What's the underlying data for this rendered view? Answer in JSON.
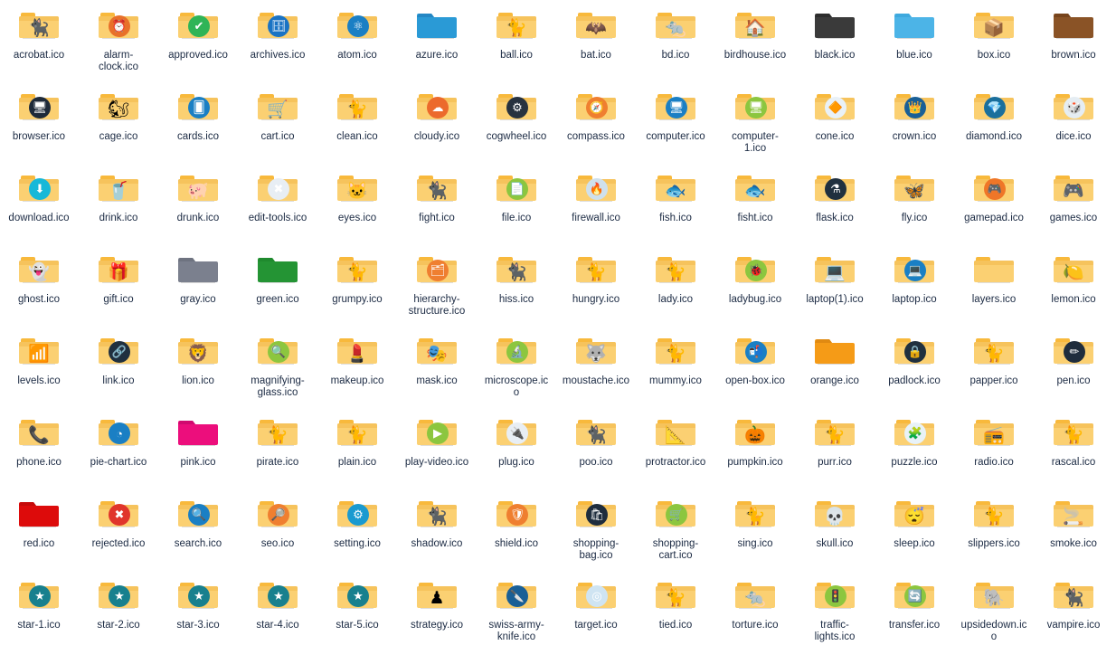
{
  "view": {
    "type": "file-explorer-icon-grid",
    "columns": 14,
    "rows": 7,
    "background": "#ffffff",
    "label_color": "#1b2a43",
    "folder_colors": {
      "yellow_body": "#fbd072",
      "yellow_tab": "#f8b93c",
      "yellow_edge": "#f6c35c",
      "blue": "#2a9ad6",
      "light_blue": "#4cb4e7",
      "black": "#333333",
      "brown": "#8a5326",
      "gray": "#7b808e",
      "green": "#249434",
      "orange": "#f59b17",
      "pink": "#ec0e7c",
      "red": "#dd0b0b",
      "shadow": "#c9c9c9"
    }
  },
  "files": [
    {
      "name": "acrobat.ico",
      "folder": "yellow",
      "glyph": "🐈‍⬛",
      "icon_name": "black-cat"
    },
    {
      "name": "alarm-clock.ico",
      "folder": "yellow",
      "glyph": "⏰",
      "icon_name": "alarm-clock",
      "disc": "#e8702a"
    },
    {
      "name": "approved.ico",
      "folder": "yellow",
      "glyph": "✔",
      "icon_name": "check-mark",
      "disc": "#2fb457"
    },
    {
      "name": "archives.ico",
      "folder": "yellow",
      "glyph": "🗄",
      "icon_name": "archive-box",
      "disc": "#1a73c4"
    },
    {
      "name": "atom.ico",
      "folder": "yellow",
      "glyph": "⚛",
      "icon_name": "atom",
      "disc": "#1b7fc4"
    },
    {
      "name": "azure.ico",
      "folder": "blue",
      "glyph": "",
      "icon_name": "plain-blue-folder"
    },
    {
      "name": "ball.ico",
      "folder": "yellow",
      "glyph": "🐈",
      "icon_name": "cat-with-ball"
    },
    {
      "name": "bat.ico",
      "folder": "yellow",
      "glyph": "🦇",
      "icon_name": "bat"
    },
    {
      "name": "bd.ico",
      "folder": "yellow",
      "glyph": "🐀",
      "icon_name": "rodent"
    },
    {
      "name": "birdhouse.ico",
      "folder": "yellow",
      "glyph": "🏠",
      "icon_name": "birdhouse"
    },
    {
      "name": "black.ico",
      "folder": "black",
      "glyph": "",
      "icon_name": "plain-black-folder"
    },
    {
      "name": "blue.ico",
      "folder": "light_blue",
      "glyph": "",
      "icon_name": "plain-lightblue-folder"
    },
    {
      "name": "box.ico",
      "folder": "yellow",
      "glyph": "📦",
      "icon_name": "cat-in-box"
    },
    {
      "name": "brown.ico",
      "folder": "brown",
      "glyph": "",
      "icon_name": "plain-brown-folder"
    },
    {
      "name": "browser.ico",
      "folder": "yellow",
      "glyph": "🖥",
      "icon_name": "browser-window",
      "disc": "#1e2a3a"
    },
    {
      "name": "cage.ico",
      "folder": "yellow",
      "glyph": "🐿",
      "icon_name": "caged-animal"
    },
    {
      "name": "cards.ico",
      "folder": "yellow",
      "glyph": "🂠",
      "icon_name": "playing-cards",
      "disc": "#1a7fc4"
    },
    {
      "name": "cart.ico",
      "folder": "yellow",
      "glyph": "🛒",
      "icon_name": "shopping-basket"
    },
    {
      "name": "clean.ico",
      "folder": "yellow",
      "glyph": "🐈",
      "icon_name": "grey-cat"
    },
    {
      "name": "cloudy.ico",
      "folder": "yellow",
      "glyph": "☁",
      "icon_name": "cloud",
      "disc": "#ec6a2c"
    },
    {
      "name": "cogwheel.ico",
      "folder": "yellow",
      "glyph": "⚙",
      "icon_name": "cogwheel",
      "disc": "#27323f"
    },
    {
      "name": "compass.ico",
      "folder": "yellow",
      "glyph": "🧭",
      "icon_name": "compass",
      "disc": "#ef7f30"
    },
    {
      "name": "computer.ico",
      "folder": "yellow",
      "glyph": "🖥",
      "icon_name": "computer-monitor",
      "disc": "#1a7fc4"
    },
    {
      "name": "computer-1.ico",
      "folder": "yellow",
      "glyph": "🖥",
      "icon_name": "computer-monitor-alt",
      "disc": "#8cc63f"
    },
    {
      "name": "cone.ico",
      "folder": "yellow",
      "glyph": "🔶",
      "icon_name": "traffic-cone",
      "disc": "#e9f1f7"
    },
    {
      "name": "crown.ico",
      "folder": "yellow",
      "glyph": "👑",
      "icon_name": "crown",
      "disc": "#1a5f96"
    },
    {
      "name": "diamond.ico",
      "folder": "yellow",
      "glyph": "💎",
      "icon_name": "diamond",
      "disc": "#1a6f9c"
    },
    {
      "name": "dice.ico",
      "folder": "yellow",
      "glyph": "🎲",
      "icon_name": "dice",
      "disc": "#e5edf3"
    },
    {
      "name": "download.ico",
      "folder": "yellow",
      "glyph": "⬇",
      "icon_name": "download-arrow",
      "disc": "#17b8d8"
    },
    {
      "name": "drink.ico",
      "folder": "yellow",
      "glyph": "🥤",
      "icon_name": "cat-drinking"
    },
    {
      "name": "drunk.ico",
      "folder": "yellow",
      "glyph": "🐖",
      "icon_name": "drunk-animal"
    },
    {
      "name": "edit-tools.ico",
      "folder": "yellow",
      "glyph": "✖",
      "icon_name": "close-cross",
      "disc": "#e8eef4"
    },
    {
      "name": "eyes.ico",
      "folder": "yellow",
      "glyph": "🐱",
      "icon_name": "white-cat-eyes"
    },
    {
      "name": "fight.ico",
      "folder": "yellow",
      "glyph": "🐈‍⬛",
      "icon_name": "fighting-cat"
    },
    {
      "name": "file.ico",
      "folder": "yellow",
      "glyph": "📄",
      "icon_name": "file-document",
      "disc": "#8cc63f"
    },
    {
      "name": "firewall.ico",
      "folder": "yellow",
      "glyph": "🔥",
      "icon_name": "firewall",
      "disc": "#cfe0ec"
    },
    {
      "name": "fish.ico",
      "folder": "yellow",
      "glyph": "🐟",
      "icon_name": "cat-and-fishbowl"
    },
    {
      "name": "fisht.ico",
      "folder": "yellow",
      "glyph": "🐟",
      "icon_name": "fish-tank"
    },
    {
      "name": "flask.ico",
      "folder": "yellow",
      "glyph": "⚗",
      "icon_name": "flask",
      "disc": "#20303f"
    },
    {
      "name": "fly.ico",
      "folder": "yellow",
      "glyph": "🦋",
      "icon_name": "flying-creature"
    },
    {
      "name": "gamepad.ico",
      "folder": "yellow",
      "glyph": "🎮",
      "icon_name": "gamepad",
      "disc": "#ef7628"
    },
    {
      "name": "games.ico",
      "folder": "yellow",
      "glyph": "🎮",
      "icon_name": "game-controller"
    },
    {
      "name": "ghost.ico",
      "folder": "yellow",
      "glyph": "👻",
      "icon_name": "ghost-cat"
    },
    {
      "name": "gift.ico",
      "folder": "yellow",
      "glyph": "🎁",
      "icon_name": "gift-cat"
    },
    {
      "name": "gray.ico",
      "folder": "gray",
      "glyph": "",
      "icon_name": "plain-gray-folder"
    },
    {
      "name": "green.ico",
      "folder": "green",
      "glyph": "",
      "icon_name": "plain-green-folder"
    },
    {
      "name": "grumpy.ico",
      "folder": "yellow",
      "glyph": "🐈",
      "icon_name": "grumpy-cat"
    },
    {
      "name": "hierarchy-structure.ico",
      "folder": "yellow",
      "glyph": "🗂",
      "icon_name": "hierarchy-structure",
      "disc": "#ef7f30"
    },
    {
      "name": "hiss.ico",
      "folder": "yellow",
      "glyph": "🐈‍⬛",
      "icon_name": "hissing-cat"
    },
    {
      "name": "hungry.ico",
      "folder": "yellow",
      "glyph": "🐈",
      "icon_name": "hungry-cat"
    },
    {
      "name": "lady.ico",
      "folder": "yellow",
      "glyph": "🐈",
      "icon_name": "lady-cat"
    },
    {
      "name": "ladybug.ico",
      "folder": "yellow",
      "glyph": "🐞",
      "icon_name": "ladybug",
      "disc": "#8cc63f"
    },
    {
      "name": "laptop(1).ico",
      "folder": "yellow",
      "glyph": "💻",
      "icon_name": "laptop"
    },
    {
      "name": "laptop.ico",
      "folder": "yellow",
      "glyph": "💻",
      "icon_name": "laptop-alt",
      "disc": "#1a7fc4"
    },
    {
      "name": "layers.ico",
      "folder": "plain_yellow",
      "glyph": "",
      "icon_name": "layers-folder"
    },
    {
      "name": "lemon.ico",
      "folder": "yellow",
      "glyph": "🍋",
      "icon_name": "lemon"
    },
    {
      "name": "levels.ico",
      "folder": "yellow",
      "glyph": "📶",
      "icon_name": "levels-bars"
    },
    {
      "name": "link.ico",
      "folder": "yellow",
      "glyph": "🔗",
      "icon_name": "link-chain",
      "disc": "#20303f"
    },
    {
      "name": "lion.ico",
      "folder": "yellow",
      "glyph": "🦁",
      "icon_name": "lion"
    },
    {
      "name": "magnifying-glass.ico",
      "folder": "yellow",
      "glyph": "🔍",
      "icon_name": "magnifying-glass",
      "disc": "#8cc63f"
    },
    {
      "name": "makeup.ico",
      "folder": "yellow",
      "glyph": "💄",
      "icon_name": "makeup"
    },
    {
      "name": "mask.ico",
      "folder": "yellow",
      "glyph": "🎭",
      "icon_name": "mask"
    },
    {
      "name": "microscope.ico",
      "folder": "yellow",
      "glyph": "🔬",
      "icon_name": "microscope",
      "disc": "#8cc63f"
    },
    {
      "name": "moustache.ico",
      "folder": "yellow",
      "glyph": "🐺",
      "icon_name": "moustache-animal"
    },
    {
      "name": "mummy.ico",
      "folder": "yellow",
      "glyph": "🐈",
      "icon_name": "mummy-cat"
    },
    {
      "name": "open-box.ico",
      "folder": "yellow",
      "glyph": "📬",
      "icon_name": "open-box",
      "disc": "#1a7fc4"
    },
    {
      "name": "orange.ico",
      "folder": "orange",
      "glyph": "",
      "icon_name": "plain-orange-folder"
    },
    {
      "name": "padlock.ico",
      "folder": "yellow",
      "glyph": "🔒",
      "icon_name": "padlock",
      "disc": "#20303f"
    },
    {
      "name": "papper.ico",
      "folder": "yellow",
      "glyph": "🐈",
      "icon_name": "paper-cat"
    },
    {
      "name": "pen.ico",
      "folder": "yellow",
      "glyph": "✏",
      "icon_name": "pen",
      "disc": "#1f2d3d"
    },
    {
      "name": "phone.ico",
      "folder": "yellow",
      "glyph": "📞",
      "icon_name": "phone-cat"
    },
    {
      "name": "pie-chart.ico",
      "folder": "yellow",
      "glyph": "◔",
      "icon_name": "pie-chart",
      "disc": "#1a7fc4"
    },
    {
      "name": "pink.ico",
      "folder": "pink",
      "glyph": "",
      "icon_name": "plain-pink-folder"
    },
    {
      "name": "pirate.ico",
      "folder": "yellow",
      "glyph": "🐈",
      "icon_name": "pirate-cat"
    },
    {
      "name": "plain.ico",
      "folder": "yellow",
      "glyph": "🐈",
      "icon_name": "plain-cat"
    },
    {
      "name": "play-video.ico",
      "folder": "yellow",
      "glyph": "▶",
      "icon_name": "play-video",
      "disc": "#8cc63f"
    },
    {
      "name": "plug.ico",
      "folder": "yellow",
      "glyph": "🔌",
      "icon_name": "plug",
      "disc": "#e8eef4"
    },
    {
      "name": "poo.ico",
      "folder": "yellow",
      "glyph": "🐈‍⬛",
      "icon_name": "poo-cat"
    },
    {
      "name": "protractor.ico",
      "folder": "yellow",
      "glyph": "📐",
      "icon_name": "protractor"
    },
    {
      "name": "pumpkin.ico",
      "folder": "yellow",
      "glyph": "🎃",
      "icon_name": "pumpkin-cat"
    },
    {
      "name": "purr.ico",
      "folder": "yellow",
      "glyph": "🐈",
      "icon_name": "purring-cat"
    },
    {
      "name": "puzzle.ico",
      "folder": "yellow",
      "glyph": "🧩",
      "icon_name": "puzzle-piece",
      "disc": "#e8f2f8"
    },
    {
      "name": "radio.ico",
      "folder": "yellow",
      "glyph": "📻",
      "icon_name": "radio-microphone"
    },
    {
      "name": "rascal.ico",
      "folder": "yellow",
      "glyph": "🐈",
      "icon_name": "rascal-cat"
    },
    {
      "name": "red.ico",
      "folder": "red",
      "glyph": "",
      "icon_name": "plain-red-folder"
    },
    {
      "name": "rejected.ico",
      "folder": "yellow",
      "glyph": "✖",
      "icon_name": "rejected-cross",
      "disc": "#e0352b"
    },
    {
      "name": "search.ico",
      "folder": "yellow",
      "glyph": "🔍",
      "icon_name": "search-magnifier",
      "disc": "#1a7fc4"
    },
    {
      "name": "seo.ico",
      "folder": "yellow",
      "glyph": "🔎",
      "icon_name": "seo-magnifier",
      "disc": "#ef7f30"
    },
    {
      "name": "setting.ico",
      "folder": "yellow",
      "glyph": "⚙",
      "icon_name": "settings-gear",
      "disc": "#1a9ad0"
    },
    {
      "name": "shadow.ico",
      "folder": "yellow",
      "glyph": "🐈‍⬛",
      "icon_name": "shadow-cat"
    },
    {
      "name": "shield.ico",
      "folder": "yellow",
      "glyph": "🛡",
      "icon_name": "shield",
      "disc": "#ef7f30"
    },
    {
      "name": "shopping-bag.ico",
      "folder": "yellow",
      "glyph": "🛍",
      "icon_name": "shopping-bag",
      "disc": "#1f2d3d"
    },
    {
      "name": "shopping-cart.ico",
      "folder": "yellow",
      "glyph": "🛒",
      "icon_name": "shopping-cart",
      "disc": "#8cc63f"
    },
    {
      "name": "sing.ico",
      "folder": "yellow",
      "glyph": "🐈",
      "icon_name": "singing-cat"
    },
    {
      "name": "skull.ico",
      "folder": "yellow",
      "glyph": "💀",
      "icon_name": "skull-cat"
    },
    {
      "name": "sleep.ico",
      "folder": "yellow",
      "glyph": "😴",
      "icon_name": "sleeping-cat"
    },
    {
      "name": "slippers.ico",
      "folder": "yellow",
      "glyph": "🐈",
      "icon_name": "slippers-cat"
    },
    {
      "name": "smoke.ico",
      "folder": "yellow",
      "glyph": "🚬",
      "icon_name": "smoking-cat"
    },
    {
      "name": "star-1.ico",
      "folder": "yellow",
      "glyph": "★",
      "icon_name": "star-rating-1",
      "disc": "#18808e"
    },
    {
      "name": "star-2.ico",
      "folder": "yellow",
      "glyph": "★",
      "icon_name": "star-rating-2",
      "disc": "#18808e"
    },
    {
      "name": "star-3.ico",
      "folder": "yellow",
      "glyph": "★",
      "icon_name": "star-rating-3",
      "disc": "#18808e"
    },
    {
      "name": "star-4.ico",
      "folder": "yellow",
      "glyph": "★",
      "icon_name": "star-rating-4",
      "disc": "#18808e"
    },
    {
      "name": "star-5.ico",
      "folder": "yellow",
      "glyph": "★",
      "icon_name": "star-rating-5",
      "disc": "#18808e"
    },
    {
      "name": "strategy.ico",
      "folder": "yellow",
      "glyph": "♟",
      "icon_name": "strategy-chess"
    },
    {
      "name": "swiss-army-knife.ico",
      "folder": "yellow",
      "glyph": "🔪",
      "icon_name": "swiss-army-knife",
      "disc": "#1a5f96"
    },
    {
      "name": "target.ico",
      "folder": "yellow",
      "glyph": "◎",
      "icon_name": "target",
      "disc": "#cfe4f2"
    },
    {
      "name": "tied.ico",
      "folder": "yellow",
      "glyph": "🐈",
      "icon_name": "tied-cat"
    },
    {
      "name": "torture.ico",
      "folder": "yellow",
      "glyph": "🐀",
      "icon_name": "torture-device"
    },
    {
      "name": "traffic-lights.ico",
      "folder": "yellow",
      "glyph": "🚦",
      "icon_name": "traffic-lights",
      "disc": "#8cc63f"
    },
    {
      "name": "transfer.ico",
      "folder": "yellow",
      "glyph": "🔄",
      "icon_name": "transfer-arrows",
      "disc": "#8cc63f"
    },
    {
      "name": "upsidedown.ico",
      "folder": "yellow",
      "glyph": "🐘",
      "icon_name": "upsidedown-animal"
    },
    {
      "name": "vampire.ico",
      "folder": "yellow",
      "glyph": "🐈‍⬛",
      "icon_name": "vampire-cat"
    }
  ]
}
